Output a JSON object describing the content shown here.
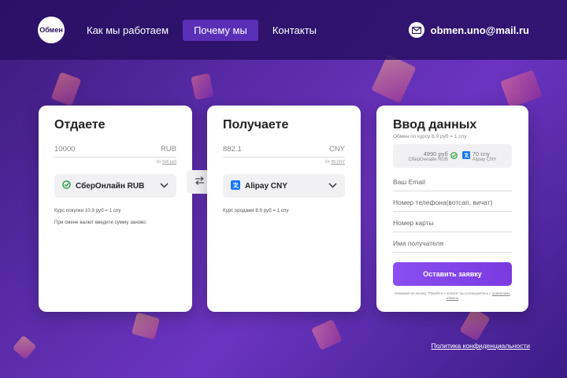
{
  "header": {
    "logo_text": "Обмен",
    "nav": [
      {
        "label": "Как мы работаем"
      },
      {
        "label": "Почему мы"
      },
      {
        "label": "Контакты"
      }
    ],
    "email": "obmen.uno@mail.ru",
    "mail_icon": "mail-icon"
  },
  "give": {
    "title": "Отдаете",
    "amount": "10000",
    "currency": "RUB",
    "minmax_prefix": "От",
    "minmax_value": "500 руб",
    "method": "СберОнлайн RUB",
    "method_icon": "sberbank-icon",
    "note_rate": "Курс покупки 10.9 руб = 1 cny",
    "note_change": "При смене валют введите сумму заново."
  },
  "get": {
    "title": "Получаете",
    "amount": "882.1",
    "currency": "CNY",
    "minmax_prefix": "От",
    "minmax_value": "30 CNY",
    "method": "Alipay CNY",
    "method_icon": "alipay-icon",
    "note_rate": "Курс продажи 8.9 руб = 1 cny"
  },
  "data": {
    "title": "Ввод данных",
    "rate_line": "Обмен по курсу 8.9 руб = 1 cny",
    "summary_give_amount": "4990 руб",
    "summary_give_method": "СберОнлайн RUB",
    "summary_get_amount": "70 cny",
    "summary_get_method": "Alipay CNY",
    "fields": {
      "email": "Ваш Email",
      "phone": "Номер телефона(вотсап, вичат)",
      "card": "Номер карты",
      "recipient": "Имя получателя"
    },
    "submit": "Оставить заявку",
    "agree_prefix": "Нажимая на кнопку \"Перейти к оплате\" вы соглашаетесь с",
    "agree_link": "правилами обмена"
  },
  "footer": {
    "privacy": "Политика конфиденциальности"
  },
  "colors": {
    "accent": "#7a3ae0",
    "header_bg": "#2a0f64",
    "background": "#5a2ba8"
  }
}
